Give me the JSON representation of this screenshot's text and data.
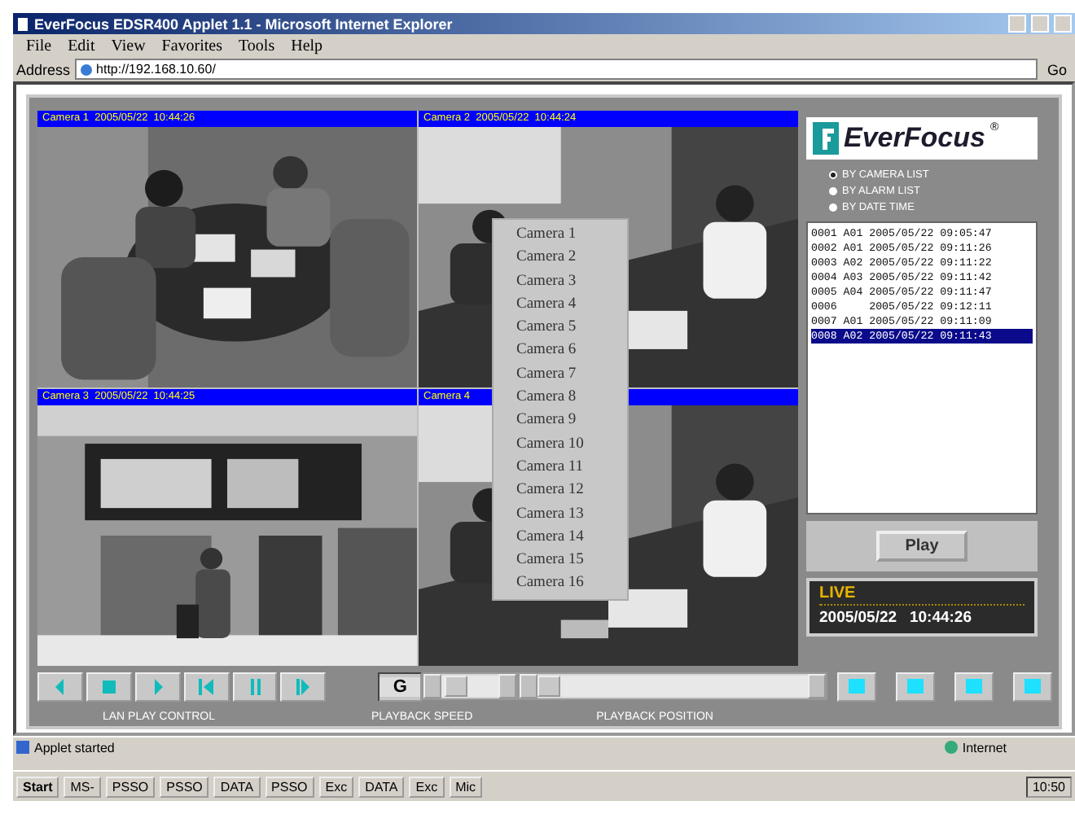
{
  "window": {
    "title": "EverFocus EDSR400 Applet 1.1 - Microsoft Internet Explorer"
  },
  "menu": [
    "File",
    "Edit",
    "View",
    "Favorites",
    "Tools",
    "Help"
  ],
  "address": {
    "label": "Address",
    "value": "http://192.168.10.60/",
    "go": "Go"
  },
  "cameras": [
    {
      "label": "Camera 1  2005/05/22  10:44:26",
      "kind": "meeting"
    },
    {
      "label": "Camera 2  2005/05/22  10:44:24",
      "kind": "office"
    },
    {
      "label": "Camera 3  2005/05/22  10:44:25",
      "kind": "station"
    },
    {
      "label": "Camera 4",
      "kind": "office"
    }
  ],
  "camera_menu": [
    "Camera 1",
    "Camera 2",
    "Camera 3",
    "Camera 4",
    "Camera 5",
    "Camera 6",
    "Camera 7",
    "Camera 8",
    "Camera 9",
    "Camera 10",
    "Camera 11",
    "Camera 12",
    "Camera 13",
    "Camera 14",
    "Camera 15",
    "Camera 16"
  ],
  "logo": {
    "text": "EverFocus",
    "mark": "®"
  },
  "list_modes": [
    {
      "label": "BY CAMERA LIST",
      "selected": true
    },
    {
      "label": "BY ALARM LIST",
      "selected": false
    },
    {
      "label": "BY DATE TIME",
      "selected": false
    }
  ],
  "events": [
    {
      "text": "0001 A01 2005/05/22 09:05:47",
      "selected": false
    },
    {
      "text": "0002 A01 2005/05/22 09:11:26",
      "selected": false
    },
    {
      "text": "0003 A02 2005/05/22 09:11:22",
      "selected": false
    },
    {
      "text": "0004 A03 2005/05/22 09:11:42",
      "selected": false
    },
    {
      "text": "0005 A04 2005/05/22 09:11:47",
      "selected": false
    },
    {
      "text": "0006     2005/05/22 09:12:11",
      "selected": false
    },
    {
      "text": "0007 A01 2005/05/22 09:11:09",
      "selected": false
    },
    {
      "text": "0008 A02 2005/05/22 09:11:43",
      "selected": true
    }
  ],
  "play": "Play",
  "live": {
    "status": "LIVE",
    "time": "2005/05/22   10:44:26"
  },
  "playback_buttons": [
    {
      "kind": "step-back"
    },
    {
      "kind": "stop"
    },
    {
      "kind": "play"
    },
    {
      "kind": "reverse"
    },
    {
      "kind": "pause"
    },
    {
      "kind": "step-forward"
    }
  ],
  "lan_label": "LAN PLAY CONTROL",
  "speed": {
    "label": "PLAYBACK SPEED",
    "value": "G",
    "level": 0.1
  },
  "position": {
    "label": "PLAYBACK POSITION",
    "level": 0
  },
  "status_bar": {
    "text": "Applet started",
    "zone": "Internet"
  },
  "taskbar": {
    "start": "Start",
    "tasks": [
      "MS-",
      "PSSO",
      "PSSO",
      "DATA",
      "PSSO",
      "Exc",
      "DATA",
      "Exc",
      "Mic"
    ],
    "clock": "10:50"
  }
}
